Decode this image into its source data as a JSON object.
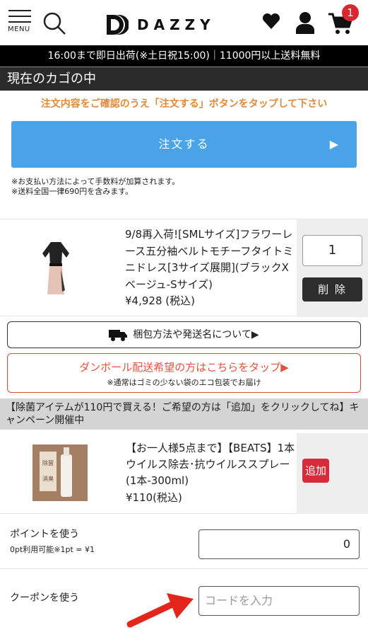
{
  "header": {
    "menu_label": "MENU",
    "logo_text": "DAZZY",
    "cart_count": "1",
    "icons": [
      "menu-icon",
      "search-icon",
      "logo-icon",
      "heart-icon",
      "user-icon",
      "cart-icon"
    ]
  },
  "ship_bar": {
    "text": "16:00まで即日出荷(※土日祝15:00)｜11000円以上送料無料"
  },
  "section": {
    "title": "現在のカゴの中"
  },
  "notice": {
    "text": "注文内容をご確認のうえ「注文する」ボタンをタップして下さい"
  },
  "order_button": {
    "label": "注文する",
    "arrow": "▶"
  },
  "notes": [
    "※お支払い方法によって手数料が加算されます。",
    "※送料全国一律690円を含みます。"
  ],
  "cart_item": {
    "name": "9/8再入荷![SMLサイズ]フラワーレース五分袖ベルトモチーフタイトミニドレス[3サイズ展開](ブラックXベージュ-Sサイズ)",
    "price": "¥4,928 (税込)",
    "quantity": "1",
    "delete_label": "削 除"
  },
  "packing_link": {
    "label": "梱包方法や発送名について▶"
  },
  "cardboard": {
    "label": "ダンボール配送希望の方はこちらをタップ▶",
    "note": "※通常はゴミの少ない袋のエコ包装でお届け"
  },
  "campaign": {
    "text": "【除菌アイテムが110円で買える！ご希望の方は「追加」をクリックしてね】キャンペーン開催中"
  },
  "upsell_item": {
    "name": "【お一人様5点まで】【BEATS】1本 ウイルス除去･抗ウイルススプレー(1本-300ml)",
    "price": "¥110(税込)",
    "add_label": "追加",
    "image_text": [
      "除菌",
      "消臭"
    ]
  },
  "points": {
    "label": "ポイントを使う",
    "sub": "0pt利用可能※1pt = ¥1",
    "value": "0"
  },
  "coupon": {
    "label": "クーポンを使う",
    "placeholder": "コードを入力"
  },
  "colors": {
    "accent_blue": "#4aa3e6",
    "notice_orange": "#e08a3a",
    "badge_red": "#d9282f",
    "add_red": "#d72b3b",
    "arrow_red": "#e3261c"
  }
}
